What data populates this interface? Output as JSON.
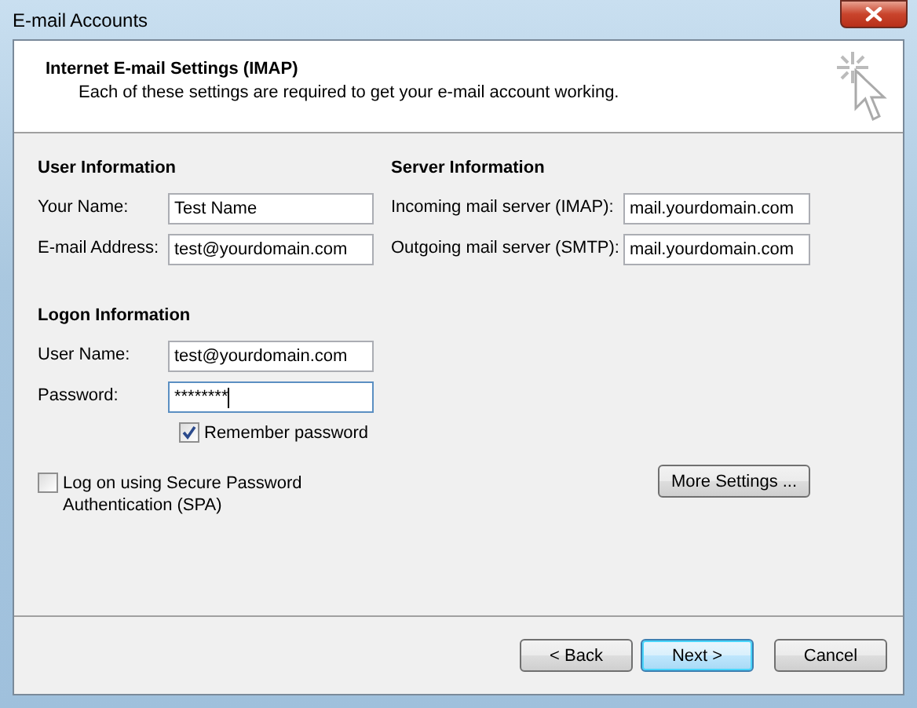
{
  "window": {
    "title": "E-mail Accounts"
  },
  "header": {
    "title": "Internet E-mail Settings (IMAP)",
    "subtitle": "Each of these settings are required to get your e-mail account working."
  },
  "user_information": {
    "heading": "User Information",
    "fields": [
      {
        "label": "Your Name:",
        "value": "Test Name",
        "focused": false
      },
      {
        "label": "E-mail Address:",
        "value": "test@yourdomain.com",
        "focused": false
      }
    ]
  },
  "server_information": {
    "heading": "Server Information",
    "fields": [
      {
        "label": "Incoming mail server (IMAP):",
        "value": "mail.yourdomain.com",
        "focused": false
      },
      {
        "label": "Outgoing mail server (SMTP):",
        "value": "mail.yourdomain.com",
        "focused": false
      }
    ]
  },
  "logon_information": {
    "heading": "Logon Information",
    "fields": [
      {
        "label": "User Name:",
        "value": "test@yourdomain.com",
        "focused": false
      },
      {
        "label": "Password:",
        "value": "********",
        "focused": true
      }
    ],
    "remember_password": {
      "label": "Remember password",
      "checked": true
    }
  },
  "spa": {
    "label": "Log on using Secure Password Authentication (SPA)",
    "checked": false
  },
  "more_settings_button": "More Settings ...",
  "buttons": [
    {
      "label": "< Back",
      "default": false
    },
    {
      "label": "Next >",
      "default": true
    },
    {
      "label": "Cancel",
      "default": false
    }
  ]
}
